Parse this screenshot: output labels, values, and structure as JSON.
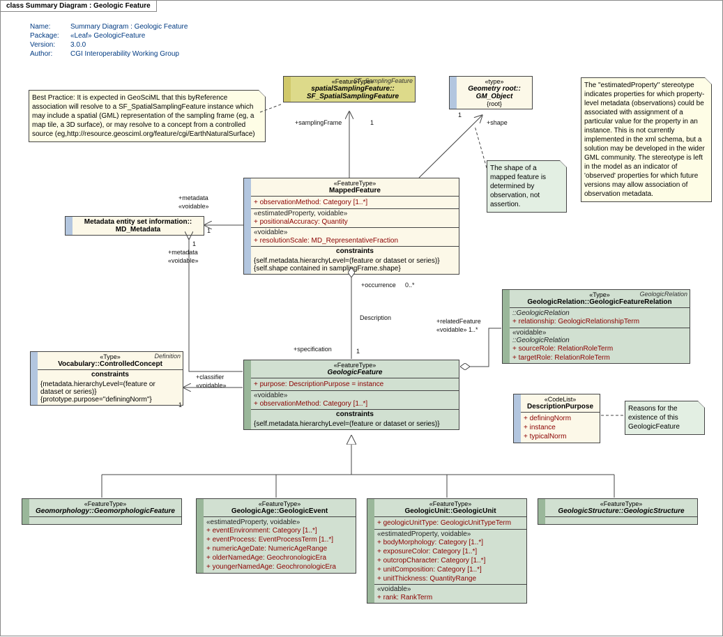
{
  "title": "class Summary Diagram : Geologic Feature",
  "meta": {
    "name_label": "Name:",
    "name": "Summary Diagram : Geologic Feature",
    "pkg_label": "Package:",
    "pkg": "«Leaf» GeologicFeature",
    "ver_label": "Version:",
    "ver": "3.0.0",
    "auth_label": "Author:",
    "auth": "CGI Interoperability Working Group"
  },
  "notes": {
    "bp": "Best Practice:  It is expected in GeoSciML that this byReference association will resolve to a SF_SpatialSamplingFeature instance which may include a spatial (GML) representation of the sampling frame (eg, a map tile, a 3D surface), or may resolve to a concept from a controlled source (eg,http://resource.geosciml.org/feature/cgi/EarthNaturalSurface)",
    "shape": "The shape of a mapped feature is determined by observation, not assertion.",
    "est": "The \"estimatedProperty\" stereotype indicates properties for which property-level metadata (observations) could be associated with assignment of a particular value for the property in an instance. This is not currently implemented in the xml schema, but a solution may be developed in the wider GML community. The stereotype is left in the model as an indicator of 'observed' properties for which future versions may allow association of observation metadata.",
    "reason": "Reasons for the existence of this GeologicFeature"
  },
  "boxes": {
    "sf": {
      "stereo": "«FeatureType»",
      "name": "spatialSamplingFeature::\nSF_SpatialSamplingFeature",
      "tag": "SF_SamplingFeature"
    },
    "gm": {
      "stereo": "«type»",
      "name": "Geometry root::\nGM_Object",
      "sub": "{root}"
    },
    "md": {
      "name": "Metadata entity set information::\nMD_Metadata"
    },
    "mf": {
      "stereo": "«FeatureType»",
      "name": "MappedFeature",
      "a1": "+   observationMethod:  Category [1..*]",
      "s1": "«estimatedProperty, voidable»",
      "a2": "+   positionalAccuracy:  Quantity",
      "s2": "«voidable»",
      "a3": "+   resolutionScale:  MD_RepresentativeFraction",
      "ctitle": "constraints",
      "c1": "{self.metadata.hierarchyLevel=(feature or dataset or series)}",
      "c2": "{self.shape contained in samplingFrame.shape}"
    },
    "cc": {
      "stereo": "«Type»",
      "name": "Vocabulary::ControlledConcept",
      "tag": "Definition",
      "ctitle": "constraints",
      "c1": "{metadata.hierarchyLevel=(feature or dataset or series)}",
      "c2": "{prototype.purpose=\"definingNorm\"}"
    },
    "gf": {
      "stereo": "«FeatureType»",
      "name": "GeologicFeature",
      "a1": "+   purpose:  DescriptionPurpose = instance",
      "s1": "«voidable»",
      "a2": "+   observationMethod:  Category [1..*]",
      "ctitle": "constraints",
      "c1": "{self.metadata.hierarchyLevel=(feature or dataset or series)}"
    },
    "gr": {
      "stereo": "«Type»",
      "name": "GeologicRelation::GeologicFeatureRelation",
      "tag": "GeologicRelation",
      "s0": "::GeologicRelation",
      "a1": "+   relationship:  GeologicRelationshipTerm",
      "s1": "«voidable»",
      "s2": "::GeologicRelation",
      "a2": "+   sourceRole:  RelationRoleTerm",
      "a3": "+   targetRole:  RelationRoleTerm"
    },
    "dp": {
      "stereo": "«CodeList»",
      "name": "DescriptionPurpose",
      "a1": "+   definingNorm",
      "a2": "+   instance",
      "a3": "+   typicalNorm"
    },
    "gmf": {
      "stereo": "«FeatureType»",
      "name": "Geomorphology::GeomorphologicFeature"
    },
    "ge": {
      "stereo": "«FeatureType»",
      "name": "GeologicAge::GeologicEvent",
      "s1": "«estimatedProperty, voidable»",
      "a1": "+   eventEnvironment:  Category [1..*]",
      "a2": "+   eventProcess:  EventProcessTerm [1..*]",
      "a3": "+   numericAgeDate:  NumericAgeRange",
      "a4": "+   olderNamedAge:  GeochronologicEra",
      "a5": "+   youngerNamedAge:  GeochronologicEra"
    },
    "gu": {
      "stereo": "«FeatureType»",
      "name": "GeologicUnit::GeologicUnit",
      "a0": "+   geologicUnitType:  GeologicUnitTypeTerm",
      "s1": "«estimatedProperty, voidable»",
      "a1": "+   bodyMorphology:  Category [1..*]",
      "a2": "+   exposureColor:  Category [1..*]",
      "a3": "+   outcropCharacter:  Category [1..*]",
      "a4": "+   unitComposition:  Category [1..*]",
      "a5": "+   unitThickness:  QuantityRange",
      "s2": "«voidable»",
      "a6": "+   rank:  RankTerm"
    },
    "gs": {
      "stereo": "«FeatureType»",
      "name": "GeologicStructure::GeologicStructure"
    }
  },
  "labels": {
    "sampFrame": "+samplingFrame",
    "shp": "+shape",
    "one": "1",
    "meta": "+metadata",
    "void": "«voidable»",
    "occ": "+occurrence",
    "zstar": "0..*",
    "desc": "Description",
    "spec": "+specification",
    "relF": "+relatedFeature",
    "v1s": "«voidable» 1..*",
    "clas": "+classifier"
  }
}
